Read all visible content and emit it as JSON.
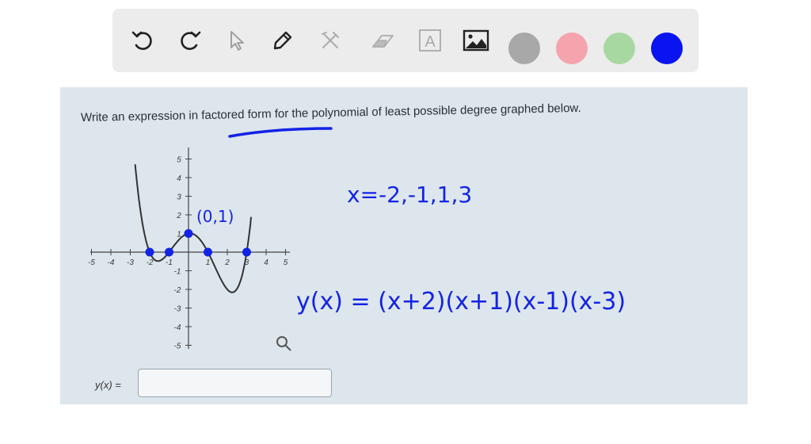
{
  "toolbar": {
    "tools": [
      {
        "name": "undo-button",
        "icon": "undo-icon"
      },
      {
        "name": "redo-button",
        "icon": "redo-icon"
      },
      {
        "name": "select-button",
        "icon": "cursor-icon"
      },
      {
        "name": "pen-button",
        "icon": "pencil-icon"
      },
      {
        "name": "tools-button",
        "icon": "hammer-wrench-icon"
      },
      {
        "name": "eraser-button",
        "icon": "eraser-icon"
      },
      {
        "name": "text-button",
        "icon": "text-box-icon"
      },
      {
        "name": "image-button",
        "icon": "image-icon"
      }
    ],
    "text_tool_letter": "A",
    "colors": [
      "#a8a8a8",
      "#f5a3ad",
      "#a8d8a2",
      "#0a14f0"
    ]
  },
  "question": {
    "prefix": "Write an expression in",
    "underlined": "factored form",
    "suffix": "for the polynomial of least possible degree graphed below."
  },
  "graph": {
    "x_ticks_neg": [
      "-5",
      "-4",
      "-3",
      "-2",
      "-1"
    ],
    "x_ticks_pos": [
      "1",
      "2",
      "3",
      "4",
      "5"
    ],
    "y_ticks_pos": [
      "1",
      "2",
      "3",
      "4",
      "5"
    ],
    "y_ticks_neg": [
      "-1",
      "-2",
      "-3",
      "-4",
      "-5"
    ],
    "roots": [
      -2,
      -1,
      1,
      3
    ],
    "y_intercept": [
      0,
      1
    ]
  },
  "annotations": {
    "point_label": "(0,1)",
    "roots_text": "x=-2,-1,1,3",
    "answer_text": "y(x) = (x+2)(x+1)(x-1)(x-3)"
  },
  "answer": {
    "label": "y(x) =",
    "value": ""
  }
}
